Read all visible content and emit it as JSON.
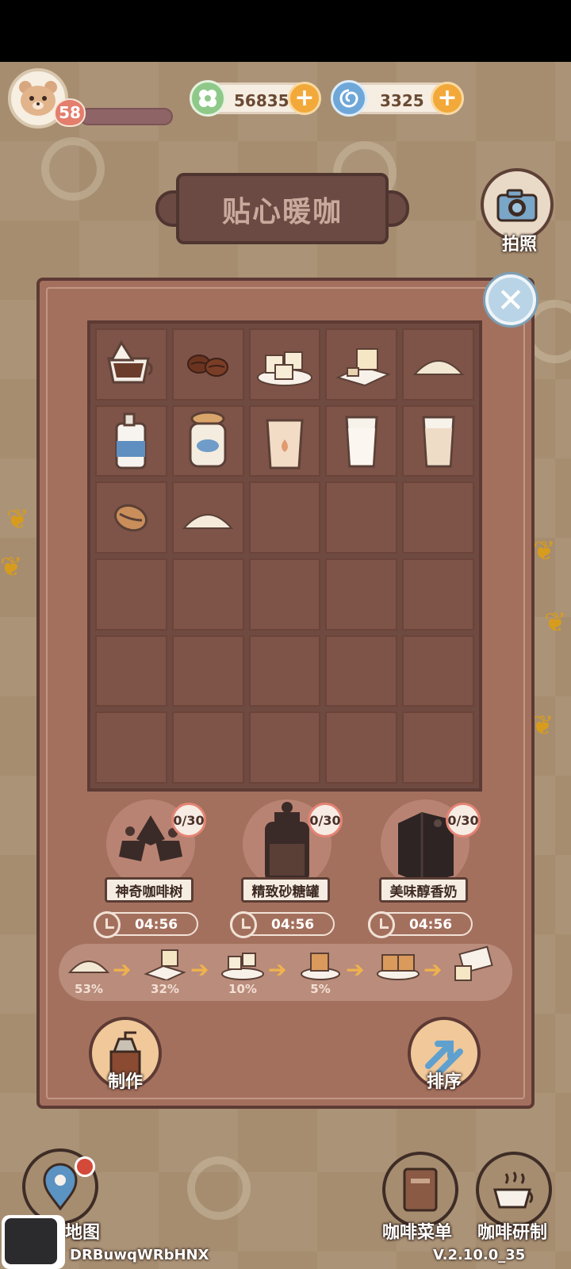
{
  "hud": {
    "level": "58",
    "currency_green": "56835",
    "currency_blue": "3325"
  },
  "title": "贴心暖咖",
  "camera_label": "拍照",
  "producers": [
    {
      "name": "神奇咖啡树",
      "count": "0/30",
      "timer": "04:56"
    },
    {
      "name": "精致砂糖罐",
      "count": "0/30",
      "timer": "04:56"
    },
    {
      "name": "美味醇香奶",
      "count": "0/30",
      "timer": "04:56"
    }
  ],
  "chain": [
    {
      "pct": "53%"
    },
    {
      "pct": "32%"
    },
    {
      "pct": "10%"
    },
    {
      "pct": "5%"
    }
  ],
  "actions": {
    "make": "制作",
    "sort": "排序"
  },
  "nav": {
    "map": "地图",
    "menu": "咖啡菜单",
    "research": "咖啡研制"
  },
  "user_id": "DRBuwqWRbHNX",
  "version": "V.2.10.0_35",
  "colors": {
    "panel": "#a4705e",
    "slot": "#7e5348",
    "accent": "#f2a93a"
  }
}
